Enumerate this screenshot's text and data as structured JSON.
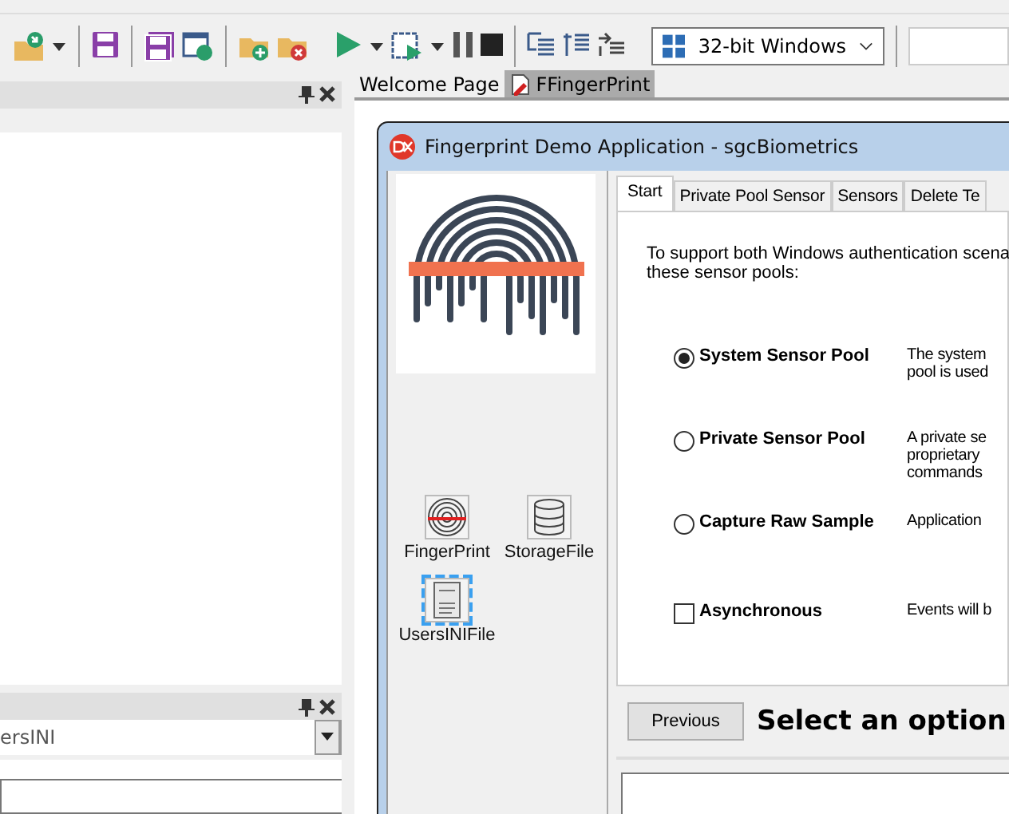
{
  "toolbar": {
    "platform_combo": {
      "value": "32-bit Windows"
    }
  },
  "left_panel": {
    "lower_combo": {
      "value": "ersINI"
    }
  },
  "editor_tabs": [
    {
      "label": "Welcome Page",
      "selected": false
    },
    {
      "label": "FFingerPrint",
      "selected": true
    }
  ],
  "form": {
    "title": "Fingerprint Demo Application - sgcBiometrics",
    "components": [
      {
        "label": "FingerPrint",
        "kind": "fingerprint",
        "selected": false
      },
      {
        "label": "StorageFile",
        "kind": "database",
        "selected": false
      },
      {
        "label": "UsersINIFile",
        "kind": "ini",
        "selected": true
      }
    ],
    "tabs": [
      {
        "label": "Start",
        "selected": true
      },
      {
        "label": "Private Pool Sensor",
        "selected": false
      },
      {
        "label": "Sensors",
        "selected": false
      },
      {
        "label": "Delete Te",
        "selected": false
      }
    ],
    "intro": [
      "To support both Windows authentication scena",
      "these sensor pools:"
    ],
    "options": [
      {
        "kind": "radio",
        "label": "System Sensor Pool",
        "checked": true,
        "description": [
          "The system",
          "pool is used"
        ]
      },
      {
        "kind": "radio",
        "label": "Private Sensor Pool",
        "checked": false,
        "description": [
          "A private se",
          "proprietary",
          "commands"
        ]
      },
      {
        "kind": "radio",
        "label": "Capture Raw Sample",
        "checked": false,
        "description": [
          "Application"
        ]
      },
      {
        "kind": "checkbox",
        "label": "Asynchronous",
        "checked": false,
        "description": [
          "Events will b"
        ]
      }
    ],
    "previous_button": "Previous",
    "heading": "Select an option"
  }
}
